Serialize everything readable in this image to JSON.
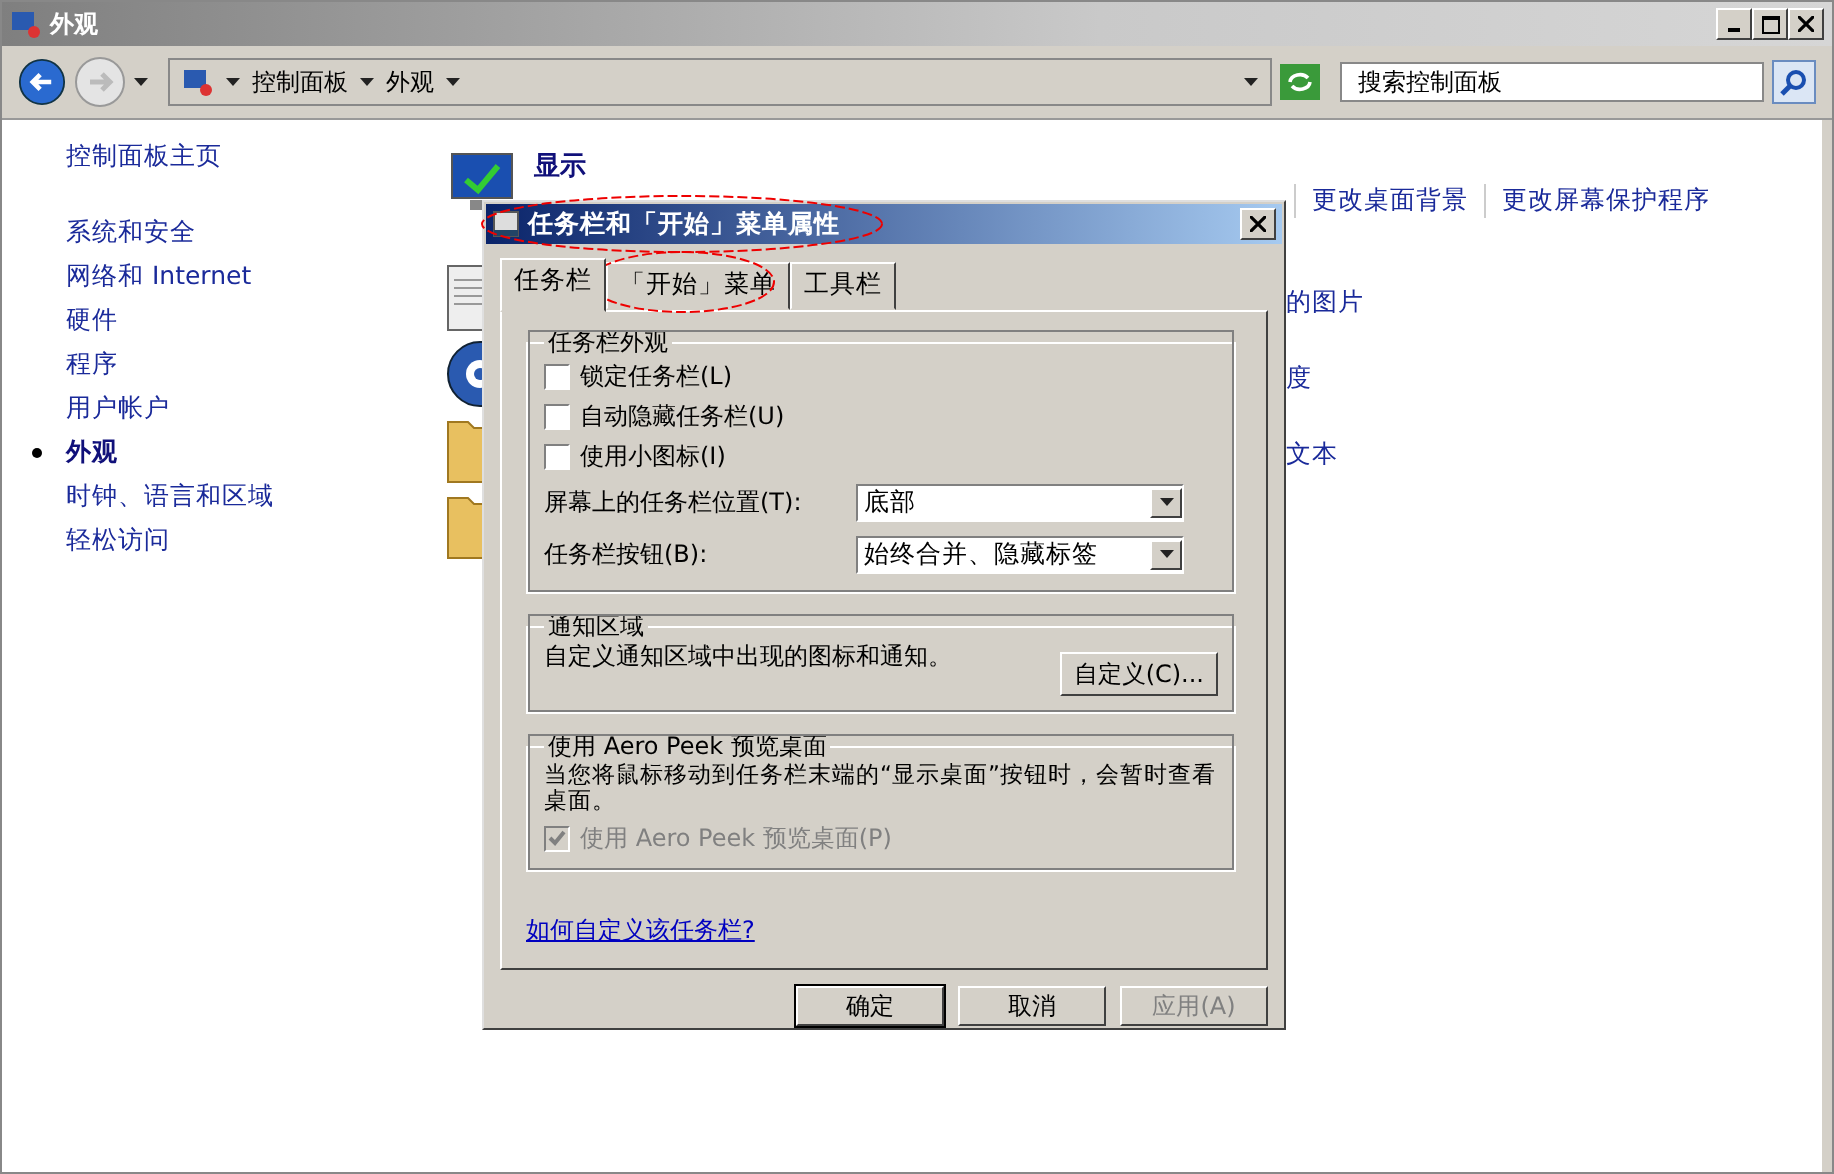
{
  "window": {
    "title": "外观"
  },
  "address_bar": {
    "breadcrumbs": [
      "控制面板",
      "外观"
    ]
  },
  "search": {
    "placeholder": "搜索控制面板"
  },
  "sidebar": {
    "home": "控制面板主页",
    "items": [
      {
        "label": "系统和安全",
        "selected": false
      },
      {
        "label": "网络和 Internet",
        "selected": false
      },
      {
        "label": "硬件",
        "selected": false
      },
      {
        "label": "程序",
        "selected": false
      },
      {
        "label": "用户帐户",
        "selected": false
      },
      {
        "label": "外观",
        "selected": true
      },
      {
        "label": "时钟、语言和区域",
        "selected": false
      },
      {
        "label": "轻松访问",
        "selected": false
      }
    ]
  },
  "display": {
    "title": "显示",
    "links": [
      "更改桌面背景",
      "更改屏幕保护程序"
    ]
  },
  "partial_links": [
    "的图片",
    "度",
    "文本"
  ],
  "dialog": {
    "title": "任务栏和「开始」菜单属性",
    "tabs": [
      {
        "label": "任务栏",
        "selected": true
      },
      {
        "label": "「开始」菜单",
        "selected": false
      },
      {
        "label": "工具栏",
        "selected": false
      }
    ],
    "appearance_group": {
      "title": "任务栏外观",
      "options": [
        {
          "label": "锁定任务栏(L)",
          "checked": false
        },
        {
          "label": "自动隐藏任务栏(U)",
          "checked": false
        },
        {
          "label": "使用小图标(I)",
          "checked": false
        }
      ],
      "fields": [
        {
          "label": "屏幕上的任务栏位置(T):",
          "value": "底部"
        },
        {
          "label": "任务栏按钮(B):",
          "value": "始终合并、隐藏标签"
        }
      ]
    },
    "notification_group": {
      "title": "通知区域",
      "text": "自定义通知区域中出现的图标和通知。",
      "button": "自定义(C)..."
    },
    "peek_group": {
      "title": "使用 Aero Peek 预览桌面",
      "text": "当您将鼠标移动到任务栏末端的“显示桌面”按钮时，会暂时查看桌面。",
      "option": {
        "label": "使用 Aero Peek 预览桌面(P)",
        "checked": true,
        "disabled": true
      }
    },
    "help_link": "如何自定义该任务栏?",
    "buttons": [
      {
        "label": "确定",
        "default": true,
        "disabled": false
      },
      {
        "label": "取消",
        "default": false,
        "disabled": false
      },
      {
        "label": "应用(A)",
        "default": false,
        "disabled": true
      }
    ]
  }
}
